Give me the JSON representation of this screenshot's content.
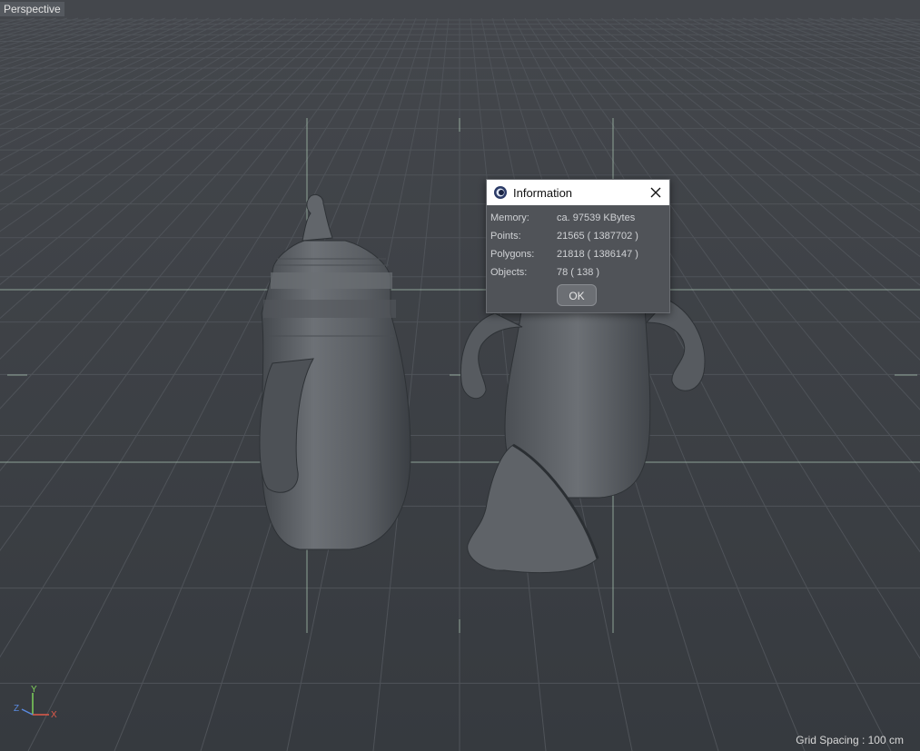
{
  "viewport": {
    "label": "Perspective",
    "grid_spacing": "Grid Spacing : 100 cm",
    "axis_labels": {
      "y": "Y",
      "z": "Z",
      "x": "X"
    }
  },
  "dialog": {
    "title": "Information",
    "app_icon": "cinema4d-logo-icon",
    "close_icon": "close-icon",
    "rows": [
      {
        "label": "Memory:",
        "value": "ca. 97539 KBytes"
      },
      {
        "label": "Points:",
        "value": "21565 ( 1387702 )"
      },
      {
        "label": "Polygons:",
        "value": "21818 ( 1386147 )"
      },
      {
        "label": "Objects:",
        "value": "78 ( 138 )"
      }
    ],
    "ok_label": "OK"
  },
  "colors": {
    "background": "#3a3d42",
    "grid_line": "#4c5056",
    "safe_frame": "#a9c4b2",
    "model": "#5d6167"
  }
}
